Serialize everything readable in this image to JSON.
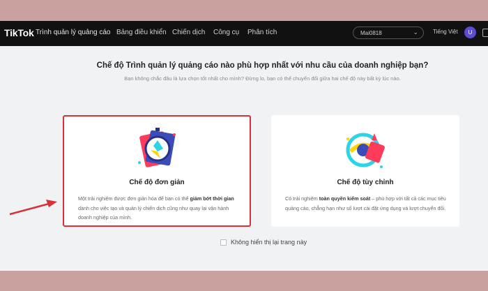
{
  "topbar": {
    "logo": "TikTok",
    "product": "Trình quản lý quảng cáo",
    "nav": [
      "Bảng điều khiển",
      "Chiến dịch",
      "Công cụ",
      "Phân tích"
    ],
    "account": "Mai0818",
    "language": "Tiếng Việt",
    "avatar_initial": "U"
  },
  "main": {
    "headline": "Chế độ Trình quản lý quảng cáo nào phù hợp nhất với nhu cầu của doanh nghiệp bạn?",
    "subline": "Bạn không chắc đâu là lựa chọn tốt nhất cho mình? Đừng lo, bạn có thể chuyển đổi giữa hai chế độ này bất kỳ lúc nào."
  },
  "cards": [
    {
      "title": "Chế độ đơn giản",
      "desc_pre": "Một trải nghiệm được đơn giản hóa để bạn có thể ",
      "desc_bold": "giảm bớt thời gian",
      "desc_post": " dành cho việc tạo và quản lý chiến dịch cũng như quay lại vận hành doanh nghiệp của mình."
    },
    {
      "title": "Chế độ tùy chỉnh",
      "desc_pre": "Có trải nghiệm ",
      "desc_bold": "toàn quyền kiểm soát",
      "desc_post": " – phù hợp với tất cả các mục tiêu quảng cáo, chẳng hạn như số lượt cài đặt ứng dụng và lượt chuyển đổi."
    }
  ],
  "checkbox_label": "Không hiển thị lại trang này",
  "colors": {
    "background": "#c9a19f",
    "topbar": "#111111",
    "highlight": "#d9313a",
    "avatar": "#5b4bd6"
  }
}
